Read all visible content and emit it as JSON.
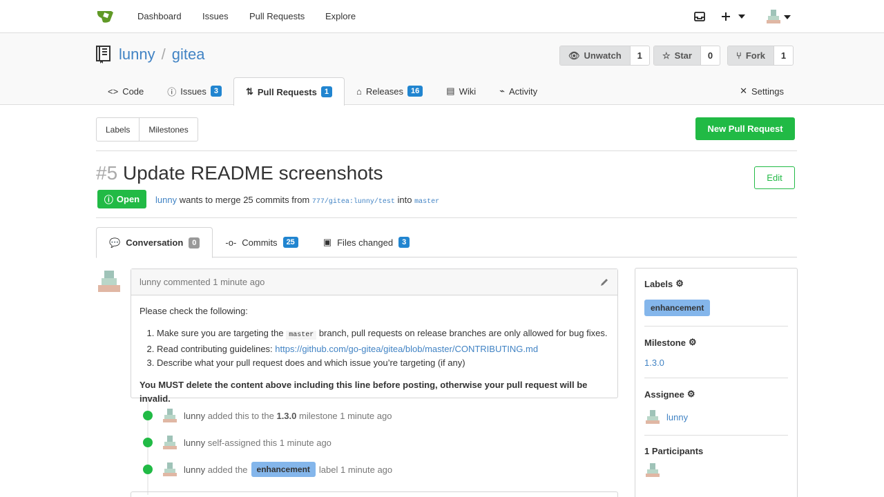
{
  "nav": {
    "links": [
      "Dashboard",
      "Issues",
      "Pull Requests",
      "Explore"
    ],
    "icons": [
      "inbox-icon",
      "plus-icon",
      "user-avatar"
    ]
  },
  "repo": {
    "owner": "lunny",
    "separator": "/",
    "name": "gitea",
    "watch": {
      "label": "Unwatch",
      "count": "1"
    },
    "star": {
      "label": "Star",
      "count": "0"
    },
    "fork": {
      "label": "Fork",
      "count": "1"
    },
    "tabs": [
      {
        "label": "Code"
      },
      {
        "label": "Issues",
        "count": "3"
      },
      {
        "label": "Pull Requests",
        "count": "1"
      },
      {
        "label": "Releases",
        "count": "16"
      },
      {
        "label": "Wiki"
      },
      {
        "label": "Activity"
      }
    ],
    "settings_label": "Settings"
  },
  "toolbar": {
    "labels": "Labels",
    "milestones": "Milestones",
    "new_pr": "New Pull Request"
  },
  "pr": {
    "number": "#5",
    "title": "Update README screenshots",
    "edit": "Edit",
    "state": "Open",
    "author": "lunny",
    "merge_text": "wants to merge 25 commits from",
    "from_branch": "777/gitea:lunny/test",
    "into_text": "into",
    "to_branch": "master"
  },
  "subtabs": [
    {
      "label": "Conversation",
      "count": "0"
    },
    {
      "label": "Commits",
      "count": "25"
    },
    {
      "label": "Files changed",
      "count": "3"
    }
  ],
  "comment": {
    "author": "lunny",
    "action": "commented",
    "time": "1 minute ago",
    "intro": "Please check the following:",
    "item1_pre": "Make sure you are targeting the",
    "item1_code": "master",
    "item1_post": "branch, pull requests on release branches are only allowed for bug fixes.",
    "item2_pre": "Read contributing guidelines:",
    "item2_link": "https://github.com/go-gitea/gitea/blob/master/CONTRIBUTING.md",
    "item3": "Describe what your pull request does and which issue you’re targeting (if any)",
    "warning": "You MUST delete the content above including this line before posting, otherwise your pull request will be invalid."
  },
  "events": [
    {
      "user": "lunny",
      "pre": "added this to the",
      "bold": "1.3.0",
      "post": "milestone 1 minute ago"
    },
    {
      "user": "lunny",
      "pre": "self-assigned this 1 minute ago"
    },
    {
      "user": "lunny",
      "pre": "added the",
      "label": "enhancement",
      "post": "label 1 minute ago"
    }
  ],
  "sidebar": {
    "labels_title": "Labels",
    "label": "enhancement",
    "milestone_title": "Milestone",
    "milestone": "1.3.0",
    "assignee_title": "Assignee",
    "assignee": "lunny",
    "participants_title": "1 Participants"
  },
  "colors": {
    "green": "#21ba45",
    "blue": "#2185d0",
    "link": "#4183c4",
    "label": "#84b6eb"
  }
}
